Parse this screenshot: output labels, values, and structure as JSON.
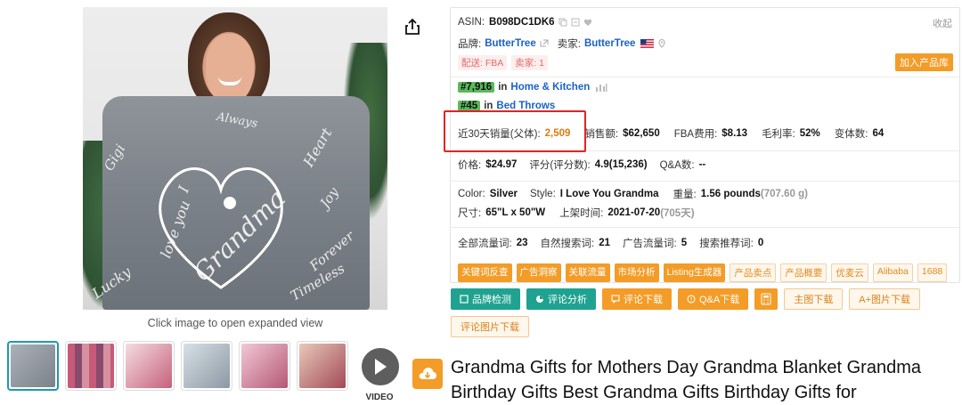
{
  "caption": "Click image to open expanded view",
  "video_label": "VIDEO",
  "product_image": {
    "script_words": [
      "I",
      "love you",
      "Grandma",
      "Heart",
      "Lucky",
      "Forever",
      "Timeless",
      "Joy",
      "Gigi",
      "Always"
    ]
  },
  "thumbnails": [
    {
      "name": "thumb-blanket",
      "color": "#8a9097"
    },
    {
      "name": "thumb-colors",
      "color": "#c75a78"
    },
    {
      "name": "thumb-quality",
      "color": "#e9c9d0"
    },
    {
      "name": "thumb-folded",
      "color": "#b8c3cc"
    },
    {
      "name": "thumb-gift-box",
      "color": "#c46a86"
    },
    {
      "name": "thumb-family",
      "color": "#b96a6f"
    }
  ],
  "panel": {
    "asin_label": "ASIN:",
    "asin": "B098DC1DK6",
    "collapse": "收起",
    "brand_label": "品牌:",
    "brand": "ButterTree",
    "seller_label": "卖家:",
    "seller": "ButterTree",
    "ship_tag": "配送: FBA",
    "sellers_tag": "卖家: 1",
    "add_library": "加入产品库",
    "rank1_num": "#7,916",
    "rank_in": "in",
    "rank1_cat": "Home & Kitchen",
    "rank2_num": "#45",
    "rank2_cat": "Bed Throws",
    "sales30_label": "近30天销量(父体):",
    "sales30": "2,509",
    "revenue_label": "销售额:",
    "revenue": "$62,650",
    "fba_label": "FBA费用:",
    "fba": "$8.13",
    "margin_label": "毛利率:",
    "margin": "52%",
    "variants_label": "变体数:",
    "variants": "64",
    "price_label": "价格:",
    "price": "$24.97",
    "rating_label": "评分(评分数):",
    "rating": "4.9(15,236)",
    "qa_label": "Q&A数:",
    "qa": "--",
    "color_label": "Color:",
    "color": "Silver",
    "style_label": "Style:",
    "style": "I Love You Grandma",
    "weight_label": "重量:",
    "weight": "1.56 pounds",
    "weight_g": "(707.60 g)",
    "size_label": "尺寸:",
    "size": "65\"L x 50\"W",
    "launch_label": "上架时间:",
    "launch": "2021-07-20",
    "launch_days": "(705天)",
    "traffic_label": "全部流量词:",
    "traffic": "23",
    "organic_label": "自然搜索词:",
    "organic": "21",
    "ads_label": "广告流量词:",
    "ads": "5",
    "recommend_label": "搜索推荐词:",
    "recommend": "0",
    "tools_solid": [
      "关键词反查",
      "广告洞察",
      "关联流量",
      "市场分析",
      "Listing生成器"
    ],
    "tools_ghost": [
      "产品卖点",
      "产品概要",
      "优麦云",
      "Alibaba",
      "1688"
    ]
  },
  "actions": {
    "brand_check": "品牌检测",
    "review_analysis": "评论分析",
    "review_download": "评论下载",
    "qa_download": "Q&A下载",
    "main_image_download": "主图下载",
    "aplus_download": "A+图片下载",
    "review_image_download": "评论图片下载"
  },
  "title": "Grandma Gifts for Mothers Day Grandma Blanket Grandma Birthday Gifts Best Grandma Gifts Birthday Gifts for",
  "colors": {
    "accent_orange": "#f39c27",
    "teal": "#1fa390",
    "link_blue": "#1a62c5",
    "rank_green": "#5cb85c",
    "highlight_red": "#e02424"
  }
}
